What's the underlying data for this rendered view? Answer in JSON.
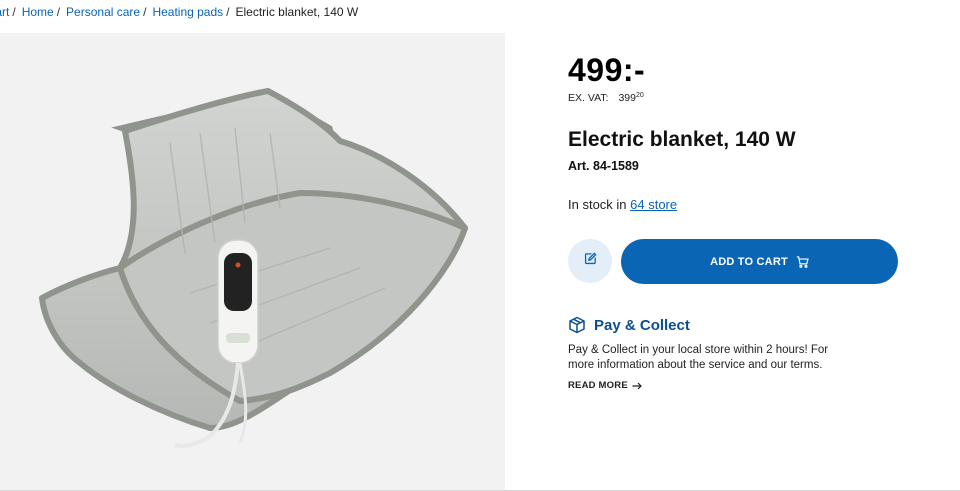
{
  "breadcrumb": {
    "items": [
      "tart",
      "Home",
      "Personal care",
      "Heating pads"
    ],
    "current": "Electric blanket, 140 W"
  },
  "product": {
    "price": "499:-",
    "exvat_label": "EX. VAT:",
    "exvat_main": "399",
    "exvat_cents": "20",
    "title": "Electric blanket,  140 W",
    "art_no": "Art. 84-1589",
    "stock_prefix": "In stock in ",
    "stock_link": "64 store"
  },
  "actions": {
    "add_to_cart": "ADD TO CART"
  },
  "pay_collect": {
    "title": "Pay & Collect",
    "text": "Pay & Collect in your local store within 2 hours! For more information about the service and our terms.",
    "read_more": "READ MORE"
  },
  "icons": {
    "edit": "edit-icon",
    "cart": "cart-icon",
    "box": "box-icon",
    "arrow": "arrow-right-icon"
  },
  "colors": {
    "accent": "#0a66b5",
    "link": "#0b63b6",
    "edit_bg": "#e4eef8",
    "image_bg": "#f2f2f2"
  }
}
